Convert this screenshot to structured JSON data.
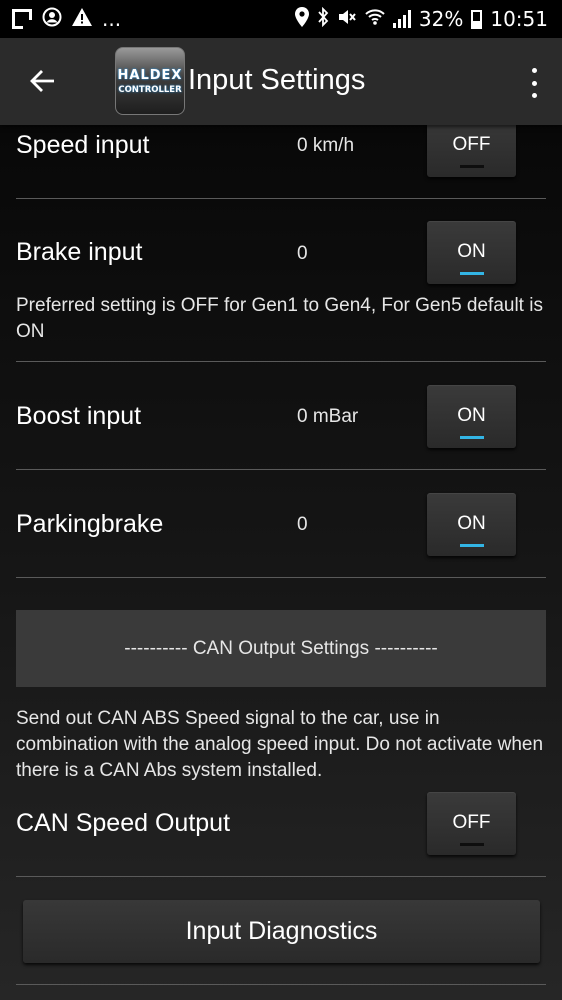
{
  "status_bar": {
    "dots": "...",
    "battery": "32%",
    "time": "10:51"
  },
  "app_bar": {
    "title": "Input Settings",
    "logo_top": "HALDEX",
    "logo_bottom": "CONTROLLER"
  },
  "rows": {
    "speed": {
      "label": "Speed input",
      "value": "0 km/h",
      "state": "OFF"
    },
    "brake": {
      "label": "Brake input",
      "value": "0",
      "state": "ON",
      "hint": "Preferred setting is OFF for Gen1 to Gen4, For Gen5 default is ON"
    },
    "boost": {
      "label": "Boost input",
      "value": "0 mBar",
      "state": "ON"
    },
    "parking": {
      "label": "Parkingbrake",
      "value": "0",
      "state": "ON"
    }
  },
  "can_section": {
    "header": "---------- CAN Output Settings ----------",
    "description": "Send out CAN ABS Speed signal to the car, use in combination with the analog speed input. Do not activate when there is a CAN Abs system installed.",
    "speed_output": {
      "label": "CAN Speed Output",
      "state": "OFF"
    }
  },
  "diagnostics_button": "Input Diagnostics",
  "colors": {
    "accent": "#33b5e5",
    "app_bar": "#2b2b2b",
    "status_bar": "#000000"
  }
}
